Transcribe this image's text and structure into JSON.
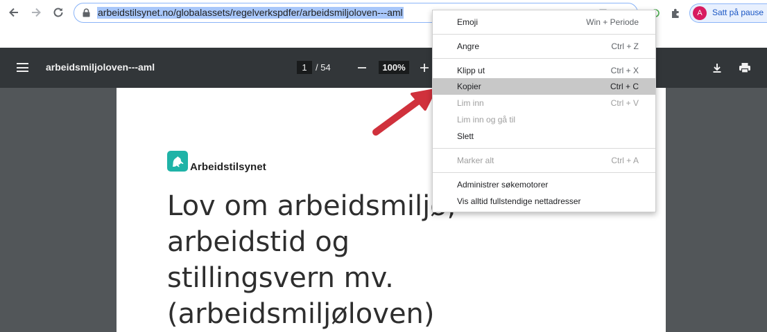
{
  "browser": {
    "url": "arbeidstilsynet.no/globalassets/regelverkspdfer/arbeidsmiljoloven---aml",
    "profile_initial": "A",
    "profile_label": "Satt på pause"
  },
  "pdf": {
    "title": "arbeidsmiljoloven---aml",
    "current_page": "1",
    "page_total": "/ 54",
    "zoom": "100%",
    "logo_text": "Arbeidstilsynet",
    "heading_lines": [
      "Lov om arbeidsmiljø,",
      "arbeidstid og",
      "stillingsvern mv.",
      "(arbeidsmiljøloven)"
    ]
  },
  "context_menu": {
    "items": [
      {
        "label": "Emoji",
        "shortcut": "Win + Periode",
        "enabled": true
      },
      {
        "label": "Angre",
        "shortcut": "Ctrl + Z",
        "enabled": true
      },
      {
        "label": "Klipp ut",
        "shortcut": "Ctrl + X",
        "enabled": true
      },
      {
        "label": "Kopier",
        "shortcut": "Ctrl + C",
        "enabled": true,
        "highlighted": true
      },
      {
        "label": "Lim inn",
        "shortcut": "Ctrl + V",
        "enabled": false
      },
      {
        "label": "Lim inn og gå til",
        "shortcut": "",
        "enabled": false
      },
      {
        "label": "Slett",
        "shortcut": "",
        "enabled": true
      },
      {
        "label": "Marker alt",
        "shortcut": "Ctrl + A",
        "enabled": false
      },
      {
        "label": "Administrer søkemotorer",
        "shortcut": "",
        "enabled": true
      },
      {
        "label": "Vis alltid fullstendige nettadresser",
        "shortcut": "",
        "enabled": true
      }
    ]
  },
  "colors": {
    "url_highlight": "#a8c7fa",
    "pdf_toolbar": "#323639",
    "pdf_canvas": "#525659",
    "logo_teal": "#1fb3a7",
    "arrow_red": "#d0313c",
    "menu_highlight": "#c8c8c8"
  },
  "icons": [
    "back-icon",
    "forward-icon",
    "reload-icon",
    "lock-icon",
    "extensions-icon",
    "menu-icon",
    "download-icon",
    "print-icon",
    "zoom-out-icon",
    "zoom-in-icon",
    "lion-logo-icon"
  ]
}
